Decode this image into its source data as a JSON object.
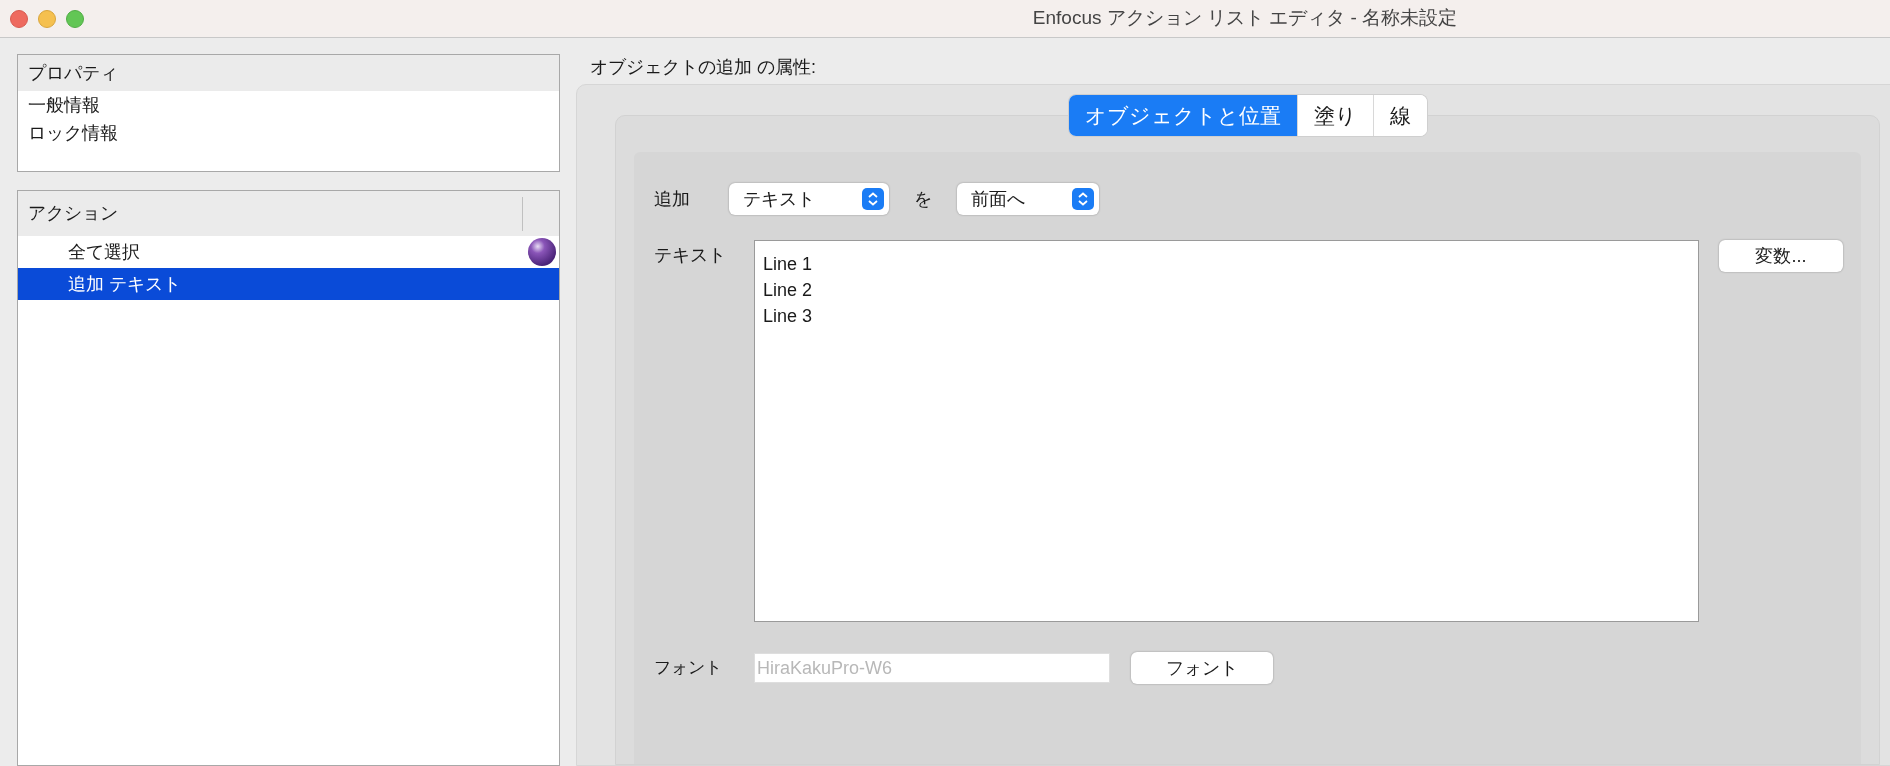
{
  "window": {
    "title": "Enfocus アクション リスト エディタ - 名称未設定"
  },
  "properties": {
    "header": "プロパティ",
    "items": [
      {
        "label": "一般情報",
        "selected": false
      },
      {
        "label": "ロック情報",
        "selected": false
      }
    ]
  },
  "actions": {
    "header": "アクション",
    "items": [
      {
        "label": "全て選択",
        "selected": false,
        "marker": true
      },
      {
        "label": "追加 テキスト",
        "selected": true,
        "marker": false
      }
    ]
  },
  "attributes_title": "オブジェクトの追加 の属性:",
  "tabs": [
    {
      "label": "オブジェクトと位置",
      "selected": true
    },
    {
      "label": "塗り",
      "selected": false
    },
    {
      "label": "線",
      "selected": false
    }
  ],
  "add_row": {
    "label": "追加",
    "object_select": "テキスト",
    "connector": "を",
    "position_select": "前面へ"
  },
  "text_field": {
    "label": "テキスト",
    "value": "Line 1\nLine 2\nLine 3",
    "variables_button": "変数..."
  },
  "font_row": {
    "label": "フォント",
    "value": "HiraKakuPro-W6",
    "disabled": true,
    "button": "フォント"
  }
}
